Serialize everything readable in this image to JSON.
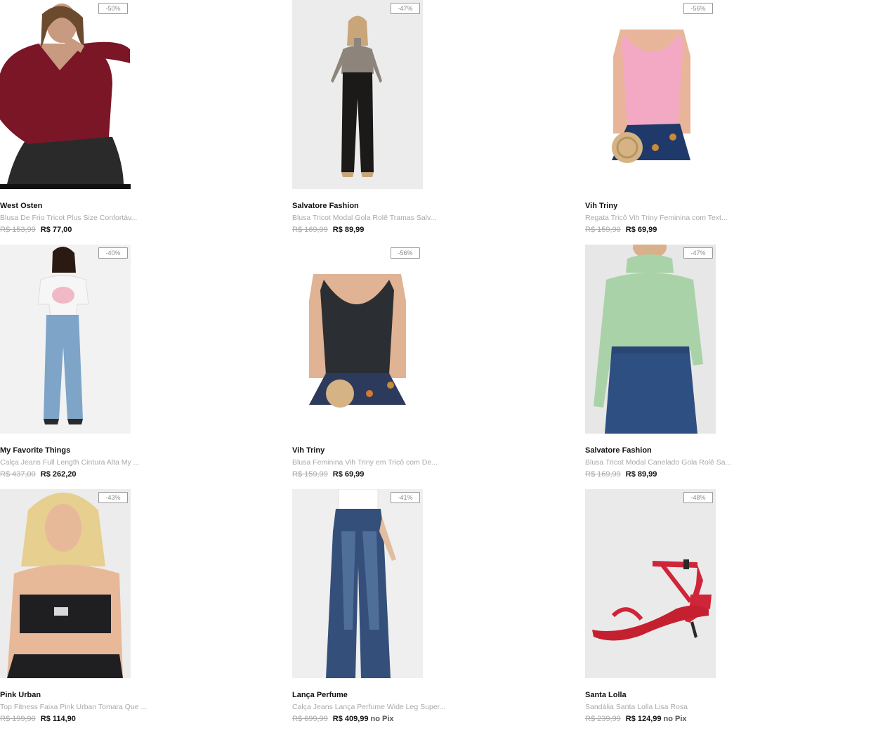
{
  "products": [
    {
      "brand": "West Osten",
      "name": "Blusa De Frio Tricot Plus Size Confortáv...",
      "old_price": "R$ 153,99",
      "price": "R$ 77,00",
      "pix": "",
      "discount": "-50%",
      "image": "model-burgundy-sweater"
    },
    {
      "brand": "Salvatore Fashion",
      "name": "Blusa Tricot Modal Gola Rolê Tramas Salv...",
      "old_price": "R$ 169,99",
      "price": "R$ 89,99",
      "pix": "",
      "discount": "-47%",
      "image": "model-grey-turtleneck-black-pants"
    },
    {
      "brand": "Vih Triny",
      "name": "Regata Tricô Vih Triny Feminina com Text...",
      "old_price": "R$ 159,90",
      "price": "R$ 69,99",
      "pix": "",
      "discount": "-56%",
      "image": "model-pink-knit-tank"
    },
    {
      "brand": "My Favorite Things",
      "name": "Calça Jeans Full Length Cintura Alta My ...",
      "old_price": "R$ 437,00",
      "price": "R$ 262,20",
      "pix": "",
      "discount": "-40%",
      "image": "model-white-tee-wide-jeans"
    },
    {
      "brand": "Vih Triny",
      "name": "Blusa Feminina Vih Triny em Tricô com De...",
      "old_price": "R$ 159,99",
      "price": "R$ 69,99",
      "pix": "",
      "discount": "-56%",
      "image": "model-black-knit-tank"
    },
    {
      "brand": "Salvatore Fashion",
      "name": "Blusa Tricot Modal Canelado Gola Rolê Sa...",
      "old_price": "R$ 169,99",
      "price": "R$ 89,99",
      "pix": "",
      "discount": "-47%",
      "image": "model-mint-turtleneck"
    },
    {
      "brand": "Pink Urban",
      "name": "Top Fitness Faixa Pink Urban Tomara Que ...",
      "old_price": "R$ 199,90",
      "price": "R$ 114,90",
      "pix": "",
      "discount": "-43%",
      "image": "model-black-bandeau-top"
    },
    {
      "brand": "Lança Perfume",
      "name": "Calça Jeans Lança Perfume Wide Leg Super...",
      "old_price": "R$ 699,99",
      "price": "R$ 409,99",
      "pix": "no Pix",
      "discount": "-41%",
      "image": "model-wide-leg-jeans"
    },
    {
      "brand": "Santa Lolla",
      "name": "Sandália Santa Lolla Lisa Rosa",
      "old_price": "R$ 239,99",
      "price": "R$ 124,99",
      "pix": "no Pix",
      "discount": "-48%",
      "image": "red-strappy-sandal"
    }
  ],
  "colors": {
    "brand_text": "#111111",
    "muted_text": "#a9a9a9",
    "badge_border": "#9a9a9a"
  }
}
